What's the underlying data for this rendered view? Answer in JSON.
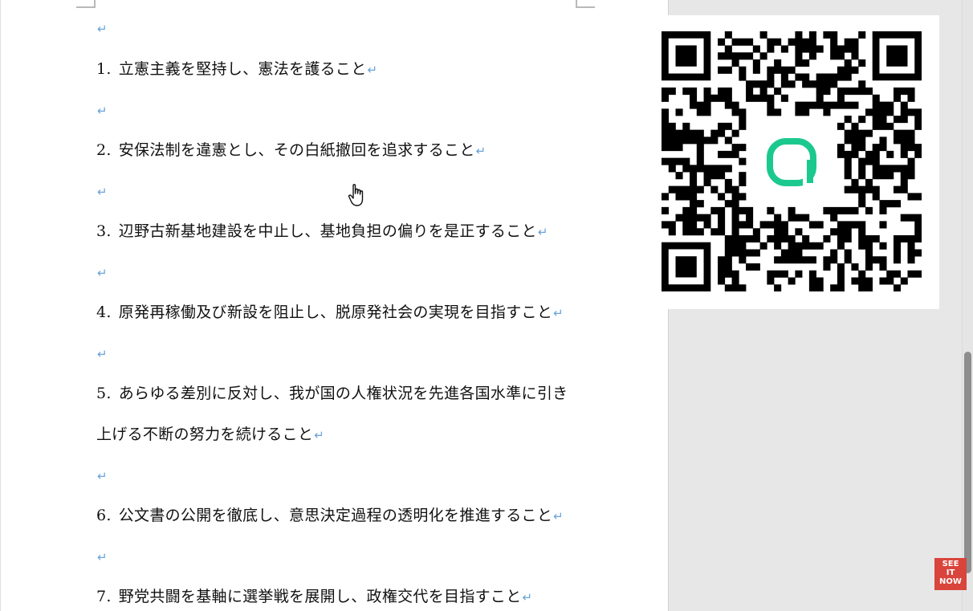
{
  "document": {
    "pilcrow": "↵",
    "items": [
      {
        "num": "1.",
        "text": "立憲主義を堅持し、憲法を護ること"
      },
      {
        "num": "2.",
        "text": "安保法制を違憲とし、その白紙撤回を追求すること"
      },
      {
        "num": "3.",
        "text": "辺野古新基地建設を中止し、基地負担の偏りを是正すること"
      },
      {
        "num": "4.",
        "text": "原発再稼働及び新設を阻止し、脱原発社会の実現を目指すこと"
      },
      {
        "num": "5.",
        "text": "あらゆる差別に反対し、我が国の人権状況を先進各国水準に引き",
        "continuation": "上げる不断の努力を続けること"
      },
      {
        "num": "6.",
        "text": "公文書の公開を徹底し、意思決定過程の透明化を推進すること"
      },
      {
        "num": "7.",
        "text": "野党共闘を基軸に選挙戦を展開し、政権交代を目指すこと"
      }
    ]
  },
  "qr": {
    "logo_color": "#1bc98e",
    "logo_icon": "app-logo-icon"
  },
  "badge": {
    "line1": "SEE",
    "line2": "IT",
    "line3": "NOW",
    "color": "#d9443c"
  },
  "cursor": {
    "icon": "hand-pointer-icon"
  }
}
